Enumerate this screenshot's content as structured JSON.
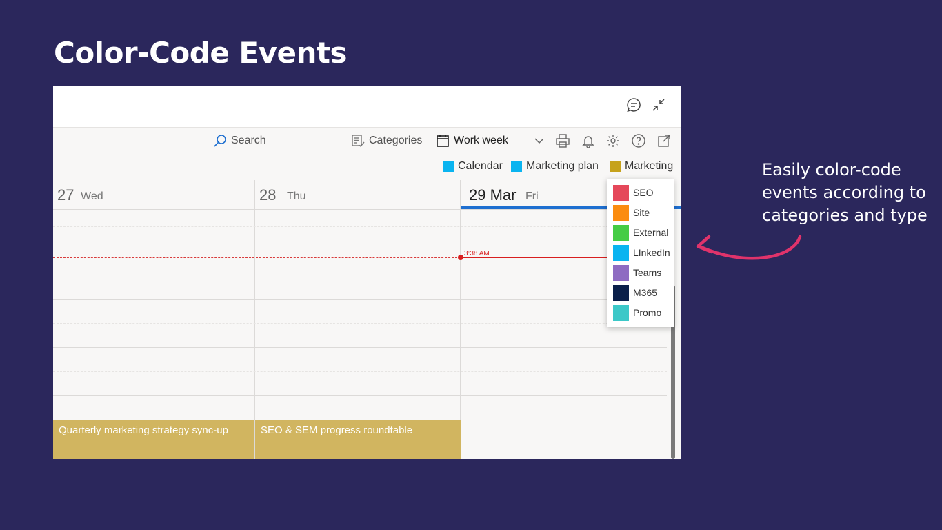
{
  "slide": {
    "title": "Color-Code Events",
    "callout": "Easily color-code events according to categories and type"
  },
  "toolbar": {
    "search_label": "Search",
    "categories_label": "Categories",
    "view_label": "Work week"
  },
  "legend": [
    {
      "label": "Calendar",
      "color": "#0ab4f0"
    },
    {
      "label": "Marketing plan",
      "color": "#0ab4f0"
    },
    {
      "label": "Marketing",
      "color": "#c6a21c"
    }
  ],
  "days": [
    {
      "num": "27",
      "name": "Wed"
    },
    {
      "num": "28",
      "name": "Thu"
    },
    {
      "num": "29 Mar",
      "name": "Fri"
    }
  ],
  "now_label": "3:38 AM",
  "events": [
    {
      "title": "Quarterly marketing strategy sync-up"
    },
    {
      "title": "SEO & SEM progress roundtable"
    }
  ],
  "categories": [
    {
      "label": "SEO",
      "color": "#e5485a"
    },
    {
      "label": "Site",
      "color": "#fb8c10"
    },
    {
      "label": "External",
      "color": "#45cc45"
    },
    {
      "label": "LInkedIn",
      "color": "#0ab4f0"
    },
    {
      "label": "Teams",
      "color": "#8e6cc2"
    },
    {
      "label": "M365",
      "color": "#0a1f4a"
    },
    {
      "label": "Promo",
      "color": "#3cc8c8"
    }
  ],
  "colors": {
    "background": "#2b275c",
    "accent_arrow": "#e0336b",
    "today_bar": "#1e6fd0",
    "now_line": "#d81f1f",
    "event_bg": "#d1b560"
  }
}
